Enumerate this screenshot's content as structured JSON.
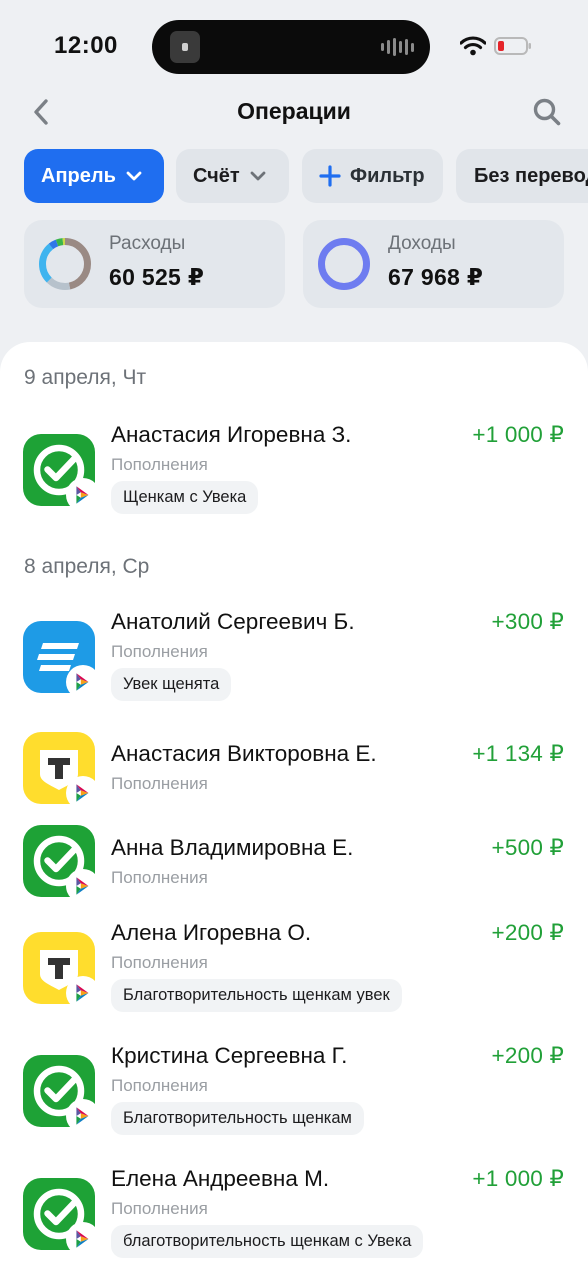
{
  "status_bar": {
    "time": "12:00"
  },
  "header": {
    "title": "Операции"
  },
  "chips": {
    "month": "Апрель",
    "account": "Счёт",
    "filter": "Фильтр",
    "no_transfers": "Без переводов"
  },
  "summary": {
    "expenses": {
      "label": "Расходы",
      "value": "60 525 ₽"
    },
    "income": {
      "label": "Доходы",
      "value": "67 968 ₽"
    }
  },
  "groups": [
    {
      "date": "9 апреля, Чт"
    },
    {
      "date": "8 апреля, Ср"
    }
  ],
  "operations": [
    {
      "name": "Анастасия Игоревна З.",
      "category": "Пополнения",
      "comment": "Щенкам с Увека",
      "amount": "+1 000 ₽",
      "bank_icon": "sber-icon"
    },
    {
      "name": "Анатолий Сергеевич Б.",
      "category": "Пополнения",
      "comment": "Увек щенята",
      "amount": "+300 ₽",
      "bank_icon": "bank-stripes-icon"
    },
    {
      "name": "Анастасия Викторовна Е.",
      "category": "Пополнения",
      "comment": "",
      "amount": "+1 134 ₽",
      "bank_icon": "t-bank-icon"
    },
    {
      "name": "Анна Владимировна Е.",
      "category": "Пополнения",
      "comment": "",
      "amount": "+500 ₽",
      "bank_icon": "sber-icon"
    },
    {
      "name": "Алена Игоревна О.",
      "category": "Пополнения",
      "comment": "Благотворительность щенкам увек",
      "amount": "+200 ₽",
      "bank_icon": "t-bank-icon"
    },
    {
      "name": "Кристина Сергеевна Г.",
      "category": "Пополнения",
      "comment": "Благотворительность щенкам",
      "amount": "+200 ₽",
      "bank_icon": "sber-icon"
    },
    {
      "name": "Елена Андреевна М.",
      "category": "Пополнения",
      "comment": "благотворительность щенкам с Увека",
      "amount": "+1 000 ₽",
      "bank_icon": "sber-icon"
    }
  ],
  "colors": {
    "accent": "#1f6ef0",
    "income_green": "#21a038",
    "sber_green": "#1ea236",
    "t_bank_yellow": "#ffdd2d",
    "bank_blue": "#1e9be6",
    "income_ring": "#6e7cf0"
  }
}
